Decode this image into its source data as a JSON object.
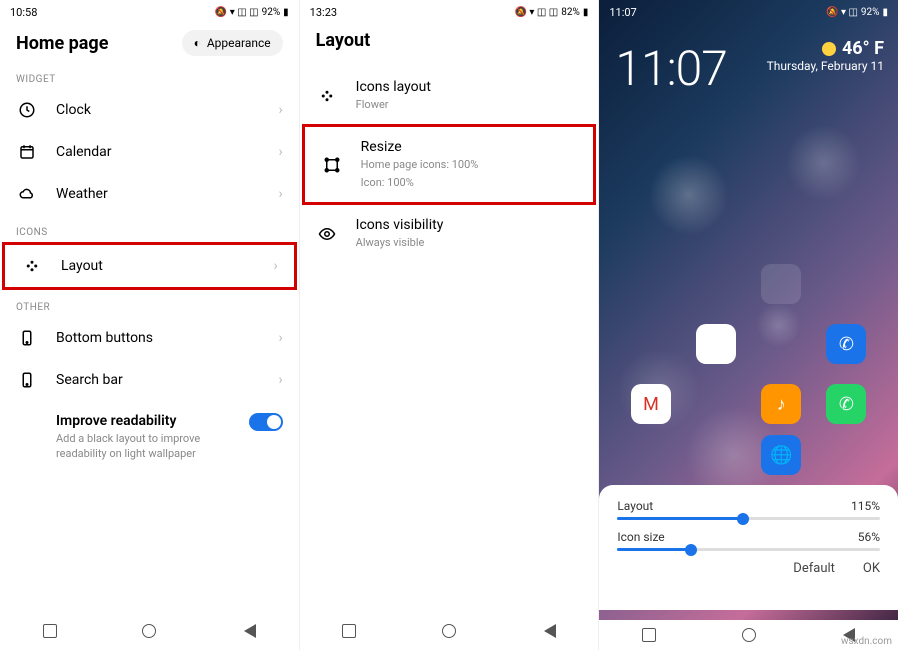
{
  "panel1": {
    "time": "10:58",
    "battery": "92%",
    "title": "Home page",
    "appearance_chip": "Appearance",
    "sections": {
      "widget": "WIDGET",
      "icons": "ICONS",
      "other": "OTHER"
    },
    "rows": {
      "clock": "Clock",
      "calendar": "Calendar",
      "weather": "Weather",
      "layout": "Layout",
      "bottom_buttons": "Bottom buttons",
      "search_bar": "Search bar"
    },
    "readability": {
      "title": "Improve readability",
      "sub": "Add a black layout to improve readability on light wallpaper",
      "on": true
    }
  },
  "panel2": {
    "time": "13:23",
    "battery": "82%",
    "title": "Layout",
    "rows": {
      "icons_layout": {
        "title": "Icons layout",
        "sub": "Flower"
      },
      "resize": {
        "title": "Resize",
        "sub1": "Home page icons: 100%",
        "sub2": "Icon: 100%"
      },
      "visibility": {
        "title": "Icons visibility",
        "sub": "Always visible"
      }
    }
  },
  "panel3": {
    "time": "11:07",
    "battery": "92%",
    "clock": "11:07",
    "temp": "46° F",
    "date": "Thursday, February 11",
    "apps": [
      {
        "name": "folder",
        "color": ""
      },
      {
        "name": "play-store",
        "color": "#fff"
      },
      {
        "name": "phone",
        "color": "#1a73e8"
      },
      {
        "name": "gmail",
        "color": "#fff"
      },
      {
        "name": "music",
        "color": "#ff9500"
      },
      {
        "name": "whatsapp",
        "color": "#25d366"
      },
      {
        "name": "browser",
        "color": "#1a73e8"
      }
    ],
    "sheet": {
      "layout_label": "Layout",
      "layout_value": "115%",
      "layout_pct": 48,
      "icon_label": "Icon size",
      "icon_value": "56%",
      "icon_pct": 28,
      "default": "Default",
      "ok": "OK"
    }
  },
  "watermark": "wsxdn.com"
}
